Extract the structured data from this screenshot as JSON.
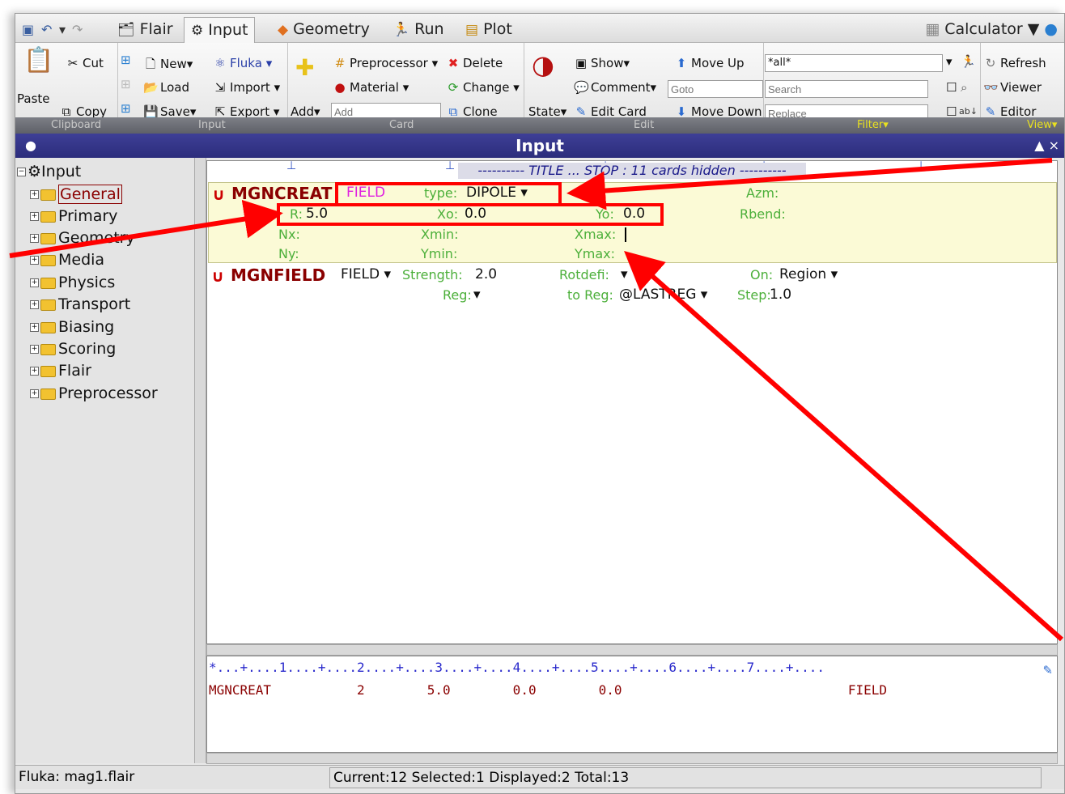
{
  "tabs": [
    "Flair",
    "Input",
    "Geometry",
    "Run",
    "Plot"
  ],
  "calculator": "Calculator",
  "ribbon": {
    "paste": "Paste",
    "cut": "Cut",
    "copy": "Copy",
    "new": "New",
    "load": "Load",
    "save": "Save",
    "fluka": "Fluka",
    "import": "Import",
    "export": "Export",
    "add": "Add",
    "add_placeholder": "Add",
    "preprocessor": "Preprocessor",
    "material": "Material",
    "delete": "Delete",
    "change": "Change",
    "clone": "Clone",
    "state": "State",
    "show": "Show",
    "comment": "Comment",
    "edit_card": "Edit Card",
    "move_up": "Move Up",
    "move_down": "Move Down",
    "goto_placeholder": "Goto",
    "filter_value": "*all*",
    "search_placeholder": "Search",
    "replace_placeholder": "Replace",
    "refresh": "Refresh",
    "viewer": "Viewer",
    "editor": "Editor"
  },
  "groups": [
    "Clipboard",
    "Input",
    "Card",
    "Edit",
    "Filter",
    "View"
  ],
  "panel_title": "Input",
  "tree": {
    "root": "Input",
    "items": [
      "General",
      "Primary",
      "Geometry",
      "Media",
      "Physics",
      "Transport",
      "Biasing",
      "Scoring",
      "Flair",
      "Preprocessor"
    ]
  },
  "title_line": "---------- TITLE ... STOP : 11 cards hidden ----------",
  "card1": {
    "name": "MGNCREAT",
    "tag": "FIELD",
    "type_label": "type:",
    "type_value": "DIPOLE",
    "azm_label": "Azm:",
    "rbend_label": "Rbend:",
    "r_label": "R:",
    "r_value": "5.0",
    "xo_label": "Xo:",
    "xo_value": "0.0",
    "yo_label": "Yo:",
    "yo_value": "0.0",
    "nx_label": "Nx:",
    "xmin_label": "Xmin:",
    "xmax_label": "Xmax:",
    "ny_label": "Ny:",
    "ymin_label": "Ymin:",
    "ymax_label": "Ymax:"
  },
  "card2": {
    "name": "MGNFIELD",
    "field": "FIELD",
    "strength_label": "Strength:",
    "strength_value": "2.0",
    "rotdefi_label": "Rotdefi:",
    "on_label": "On:",
    "on_value": "Region",
    "reg_label": "Reg:",
    "toreg_label": "to Reg:",
    "toreg_value": "@LASTREG",
    "step_label": "Step:",
    "step_value": "1.0"
  },
  "editor": {
    "ruler": "*...+....1....+....2....+....3....+....4....+....5....+....6....+....7....+....",
    "line": "MGNCREAT           2        5.0        0.0        0.0                             FIELD"
  },
  "status": {
    "left": "Fluka: mag1.flair",
    "right": "Current:12 Selected:1 Displayed:2 Total:13"
  },
  "annotation_color": "#ff0000"
}
